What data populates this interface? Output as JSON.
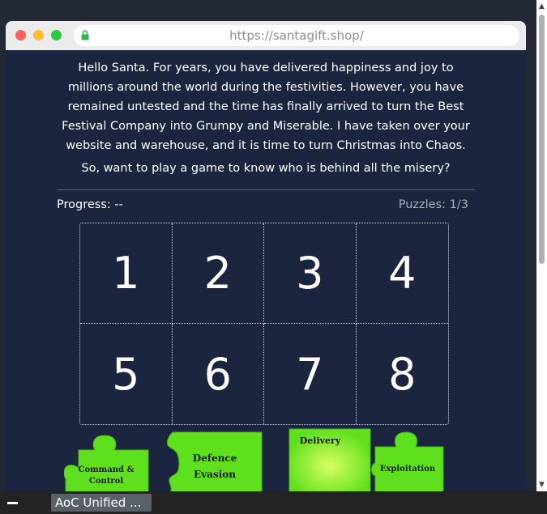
{
  "browser": {
    "url": "https://santagift.shop/"
  },
  "page": {
    "intro": "Hello Santa. For years, you have delivered happiness and joy to millions around the world during the festivities. However, you have remained untested and the time has finally arrived to turn the Best Festival Company into Grumpy and Miserable. I have taken over your website and warehouse, and it is time to turn Christmas into Chaos.",
    "question": "So, want to play a game to know who is behind all the misery?",
    "progress_label": "Progress: --",
    "puzzles_label": "Puzzles: 1/3",
    "grid": [
      "1",
      "2",
      "3",
      "4",
      "5",
      "6",
      "7",
      "8"
    ],
    "pieces": [
      {
        "line1": "Command &",
        "line2": "Control"
      },
      {
        "line1": "Defence",
        "line2": "Evasion"
      },
      {
        "line1": "Delivery",
        "line2": ""
      },
      {
        "line1": "Exploitation",
        "line2": ""
      }
    ],
    "piece_color": "#5fe01e"
  },
  "taskbar": {
    "item": "AoC Unified ..."
  },
  "colors": {
    "page_bg": "#1b2540",
    "text": "#ffffff",
    "muted": "#a8adb9",
    "traffic_red": "#ff5f57",
    "traffic_yellow": "#febc2e",
    "traffic_green": "#28c840"
  }
}
